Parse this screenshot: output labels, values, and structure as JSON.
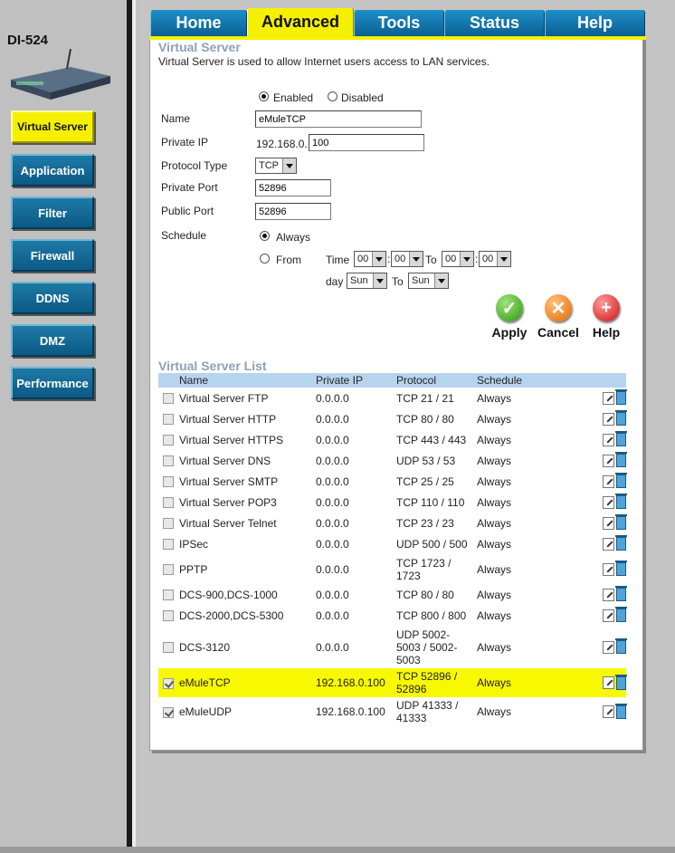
{
  "device": {
    "model": "DI-524"
  },
  "tabs": [
    {
      "label": "Home",
      "active": false
    },
    {
      "label": "Advanced",
      "active": true
    },
    {
      "label": "Tools",
      "active": false
    },
    {
      "label": "Status",
      "active": false
    },
    {
      "label": "Help",
      "active": false
    }
  ],
  "sidebar": {
    "items": [
      {
        "label": "Virtual Server",
        "active": true
      },
      {
        "label": "Application"
      },
      {
        "label": "Filter"
      },
      {
        "label": "Firewall"
      },
      {
        "label": "DDNS"
      },
      {
        "label": "DMZ"
      },
      {
        "label": "Performance"
      }
    ]
  },
  "virtual_server": {
    "title": "Virtual Server",
    "description": "Virtual Server is used to allow Internet users access to LAN services.",
    "enabled_label": "Enabled",
    "disabled_label": "Disabled",
    "enabled": true,
    "name_label": "Name",
    "name_value": "eMuleTCP",
    "private_ip_label": "Private IP",
    "private_ip_prefix": "192.168.0.",
    "private_ip_value": "100",
    "protocol_label": "Protocol Type",
    "protocol_value": "TCP",
    "private_port_label": "Private Port",
    "private_port_value": "52896",
    "public_port_label": "Public Port",
    "public_port_value": "52896",
    "schedule_label": "Schedule",
    "always_label": "Always",
    "from_label": "From",
    "schedule_mode": "Always",
    "time_label": "Time",
    "to_label": "To",
    "day_label": "day",
    "time_from_hour": "00",
    "time_from_min": "00",
    "time_to_hour": "00",
    "time_to_min": "00",
    "day_from": "Sun",
    "day_to": "Sun"
  },
  "actions": {
    "apply": "Apply",
    "cancel": "Cancel",
    "help": "Help"
  },
  "list": {
    "title": "Virtual Server List",
    "headers": {
      "name": "Name",
      "ip": "Private IP",
      "protocol": "Protocol",
      "schedule": "Schedule"
    },
    "rows": [
      {
        "checked": false,
        "name": "Virtual Server FTP",
        "ip": "0.0.0.0",
        "protocol": "TCP 21 / 21",
        "schedule": "Always"
      },
      {
        "checked": false,
        "name": "Virtual Server HTTP",
        "ip": "0.0.0.0",
        "protocol": "TCP 80 / 80",
        "schedule": "Always"
      },
      {
        "checked": false,
        "name": "Virtual Server HTTPS",
        "ip": "0.0.0.0",
        "protocol": "TCP 443 / 443",
        "schedule": "Always"
      },
      {
        "checked": false,
        "name": "Virtual Server DNS",
        "ip": "0.0.0.0",
        "protocol": "UDP 53 / 53",
        "schedule": "Always"
      },
      {
        "checked": false,
        "name": "Virtual Server SMTP",
        "ip": "0.0.0.0",
        "protocol": "TCP 25 / 25",
        "schedule": "Always"
      },
      {
        "checked": false,
        "name": "Virtual Server POP3",
        "ip": "0.0.0.0",
        "protocol": "TCP 110 / 110",
        "schedule": "Always"
      },
      {
        "checked": false,
        "name": "Virtual Server Telnet",
        "ip": "0.0.0.0",
        "protocol": "TCP 23 / 23",
        "schedule": "Always"
      },
      {
        "checked": false,
        "name": "IPSec",
        "ip": "0.0.0.0",
        "protocol": "UDP 500 / 500",
        "schedule": "Always"
      },
      {
        "checked": false,
        "name": "PPTP",
        "ip": "0.0.0.0",
        "protocol": "TCP 1723 / 1723",
        "schedule": "Always"
      },
      {
        "checked": false,
        "name": "DCS-900,DCS-1000",
        "ip": "0.0.0.0",
        "protocol": "TCP 80 / 80",
        "schedule": "Always"
      },
      {
        "checked": false,
        "name": "DCS-2000,DCS-5300",
        "ip": "0.0.0.0",
        "protocol": "TCP 800 / 800",
        "schedule": "Always"
      },
      {
        "checked": false,
        "name": "DCS-3120",
        "ip": "0.0.0.0",
        "protocol": "UDP 5002-5003 / 5002-5003",
        "schedule": "Always"
      },
      {
        "checked": true,
        "highlight": true,
        "name": "eMuleTCP",
        "ip": "192.168.0.100",
        "protocol": "TCP 52896 / 52896",
        "schedule": "Always"
      },
      {
        "checked": true,
        "name": "eMuleUDP",
        "ip": "192.168.0.100",
        "protocol": "UDP 41333 / 41333",
        "schedule": "Always"
      }
    ]
  }
}
